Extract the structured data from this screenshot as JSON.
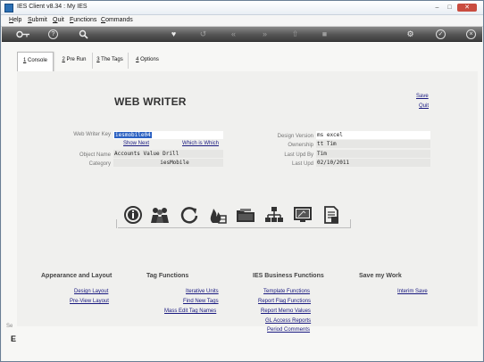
{
  "window": {
    "title": "IES Client v8.34 : My IES"
  },
  "menu": [
    "Help",
    "Submit",
    "Quit",
    "Functions",
    "Commands"
  ],
  "tabs": [
    {
      "num": "1",
      "label": "Console"
    },
    {
      "num": "2",
      "label": "Pre Run"
    },
    {
      "num": "3",
      "label": "The Tags"
    },
    {
      "num": "4",
      "label": "Options"
    }
  ],
  "page": {
    "title": "WEB WRITER",
    "save_label": "Save",
    "quit_label": "Quit"
  },
  "form": {
    "web_writer_key_label": "Web Writer Key",
    "web_writer_key_value": "iesmobile04",
    "show_next_label": "Show Next",
    "which_is_which_label": "Which is Which",
    "object_name_label": "Object Name",
    "object_name_value": "Accounts Value Drill",
    "category_label": "Category",
    "category_value": "iesMobile",
    "design_version_label": "Design Version",
    "design_version_value": "ms excel",
    "ownership_label": "Ownership",
    "ownership_value": "tt Tim",
    "last_upd_by_label": "Last Upd By",
    "last_upd_by_value": "Tim",
    "last_upd_label": "Last Upd",
    "last_upd_value": "02/10/2011"
  },
  "sections": {
    "appearance": {
      "heading": "Appearance and Layout",
      "links": [
        "Design Layout",
        "Pre-View Layout"
      ]
    },
    "tag_functions": {
      "heading": "Tag Functions",
      "links": [
        "Iterative Units",
        "Find New Tags",
        "Mass Edit Tag Names"
      ]
    },
    "business": {
      "heading": "IES Business Functions",
      "links": [
        "Template Functions",
        "Report Flag Functions",
        "Report Memo Values",
        "GL Access Reports",
        "Period Comments"
      ]
    },
    "save_work": {
      "heading": "Save my Work",
      "links": [
        "Interim Save"
      ]
    }
  },
  "icons": [
    "info-icon",
    "users-icon",
    "refresh-icon",
    "fire-icon",
    "folder-icon",
    "org-chart-icon",
    "monitor-icon",
    "document-icon"
  ],
  "corner": {
    "text": "Se",
    "letter": "E"
  }
}
